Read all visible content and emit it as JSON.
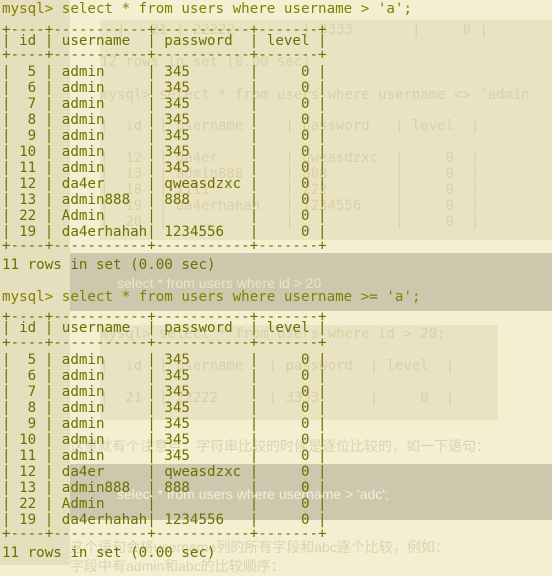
{
  "ghost": {
    "lines": [
      "|   21 | 22222        | 3333       |     0 |",
      "12 rows in set (0.00 sec)",
      "mysql> select * from users where username <> 'admin",
      "|  id  | username     | password   | level  |",
      "|  12  | da4er        | qweasdzxc  |     0  |",
      "|  13  | admin888     | 888        |     0  |",
      "|  18  | 1111         | 222        |     0  |",
      "|  19  | da4erhahah   | 1234556    |     0  |",
      "|  20  |              |            |     0  |",
      "select * from users where id > 20",
      "mysql> select * from users where id > 20;",
      "|  id  | username   | password  | level  |",
      "|  21  | 22222      | 3333      |     0  |",
      "这里就有个注意点：字符串比较的时候是逐位比较的，如一下语句：",
      "select * from users where username > 'adc';",
      "这个语句会将username列的所有字段和abc逐个比较，例如：",
      "字段中有admin和abc的比较顺序："
    ]
  },
  "queries": [
    {
      "prompt": "mysql> select * from users where username > 'a';",
      "border": "+----+-----------+-----------+-------+",
      "header": "| id | username  | password  | level |",
      "rows": [
        "|  5 | admin     | 345       |     0 |",
        "|  6 | admin     | 345       |     0 |",
        "|  7 | admin     | 345       |     0 |",
        "|  8 | admin     | 345       |     0 |",
        "|  9 | admin     | 345       |     0 |",
        "| 10 | admin     | 345       |     0 |",
        "| 11 | admin     | 345       |     0 |",
        "| 12 | da4er     | qweasdzxc |     0 |",
        "| 13 | admin888  | 888       |     0 |",
        "| 22 | Admin     |           |     0 |",
        "| 19 | da4erhahah| 1234556   |     0 |"
      ],
      "footer": "11 rows in set (0.00 sec)"
    },
    {
      "prompt": "mysql> select * from users where username >= 'a';",
      "border": "+----+-----------+-----------+-------+",
      "header": "| id | username  | password  | level |",
      "rows": [
        "|  5 | admin     | 345       |     0 |",
        "|  6 | admin     | 345       |     0 |",
        "|  7 | admin     | 345       |     0 |",
        "|  8 | admin     | 345       |     0 |",
        "|  9 | admin     | 345       |     0 |",
        "| 10 | admin     | 345       |     0 |",
        "| 11 | admin     | 345       |     0 |",
        "| 12 | da4er     | qweasdzxc |     0 |",
        "| 13 | admin888  | 888       |     0 |",
        "| 22 | Admin     |           |     0 |",
        "| 19 | da4erhahah| 1234556   |     0 |"
      ],
      "footer": "11 rows in set (0.00 sec)"
    }
  ],
  "colors": {
    "terminal_text": "#6b7000",
    "background": "#f4efd0",
    "highlight_band": "#cdc8ad"
  }
}
